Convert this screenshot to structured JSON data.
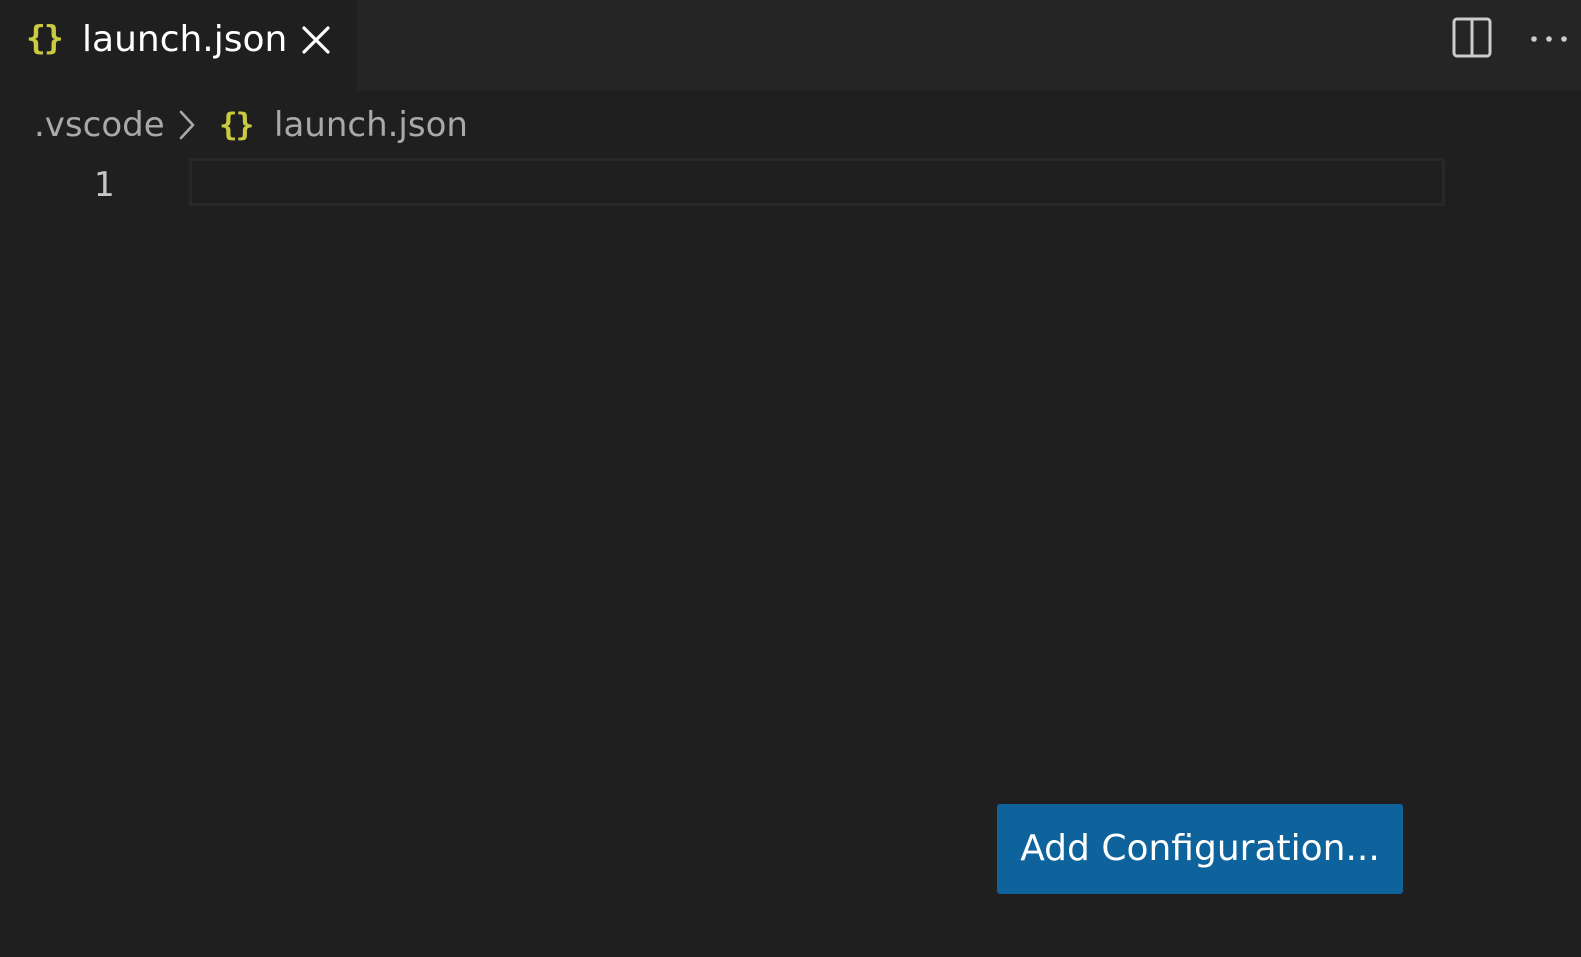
{
  "tab": {
    "label": "launch.json",
    "icon": "json-braces-icon",
    "icon_glyph": "{}",
    "close_icon": "close-icon"
  },
  "actions": {
    "split_icon": "split-editor-icon",
    "more_icon": "more-actions-icon"
  },
  "breadcrumb": {
    "folder": ".vscode",
    "separator_icon": "chevron-right-icon",
    "file_icon_glyph": "{}",
    "file": "launch.json"
  },
  "editor": {
    "line_numbers": [
      "1"
    ],
    "content": ""
  },
  "add_configuration": {
    "label": "Add Configuration..."
  },
  "colors": {
    "background": "#1f1f1f",
    "tabbar": "#252526",
    "json_icon": "#cbcb41",
    "button": "#0e639c"
  }
}
